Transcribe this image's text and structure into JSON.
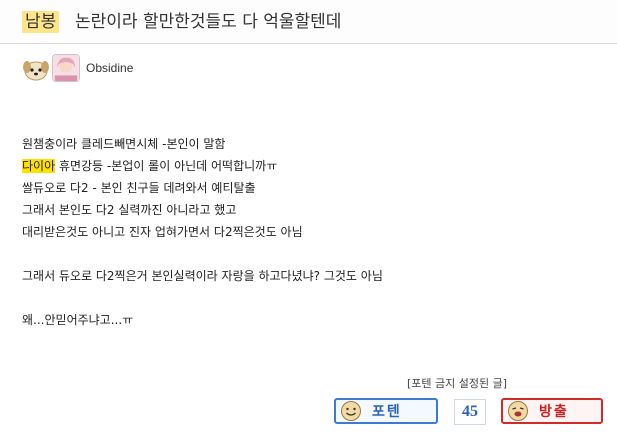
{
  "post": {
    "tag": "남봉",
    "title": "논란이라 할만한것들도 다 억울할텐데",
    "author": "Obsidine"
  },
  "content": {
    "lines": [
      {
        "pre": "",
        "highlight": "",
        "post": "원챔충이라 클레드빼면시체 -본인이 말함"
      },
      {
        "pre": "",
        "highlight": "다이아",
        "post": " 휴면강등 -본업이 롤이 아닌데 어떡합니까ㅠ"
      },
      {
        "pre": "",
        "highlight": "",
        "post": "쌀듀오로 다2 - 본인 친구들 데려와서 예티탈출"
      },
      {
        "pre": "",
        "highlight": "",
        "post": "그래서 본인도 다2 실력까진 아니라고 했고"
      },
      {
        "pre": "",
        "highlight": "",
        "post": "대리받은것도 아니고 진자 업혀가면서 다2찍은것도 아님"
      },
      {
        "pre": "",
        "highlight": "",
        "post": ""
      },
      {
        "pre": "",
        "highlight": "",
        "post": "그래서 듀오로 다2찍은거 본인실력이라 자랑을 하고다녔냐? 그것도 아님"
      },
      {
        "pre": "",
        "highlight": "",
        "post": ""
      },
      {
        "pre": "",
        "highlight": "",
        "post": "왜...안믿어주냐고...ㅠ"
      }
    ]
  },
  "footer": {
    "notice": "[포텐 금지 설정된 글]",
    "upvote_label": "포텐",
    "count": "45",
    "downvote_label": "방출"
  },
  "icons": {
    "dog": "dog-face-icon",
    "upvote": "smile-face-icon",
    "downvote": "laugh-face-icon"
  },
  "colors": {
    "highlight": "#ffe100",
    "tag_bg": "#ffe58a",
    "upvote": "#3d7bd0",
    "downvote": "#d12a2a"
  }
}
